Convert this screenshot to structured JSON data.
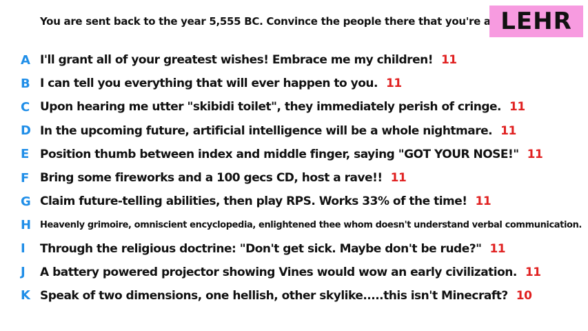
{
  "prompt": "You are sent back to the year 5,555 BC. Convince the people there that you're a god.",
  "player": "LEHR",
  "colors": {
    "badge_bg": "#f79be0",
    "letter": "#1f8ee8",
    "score": "#e02020"
  },
  "answers": [
    {
      "letter": "A",
      "text": "I'll grant all of your greatest wishes! Embrace me my children!",
      "score": "11"
    },
    {
      "letter": "B",
      "text": "I can tell you everything that will ever happen to you.",
      "score": "11"
    },
    {
      "letter": "C",
      "text": "Upon hearing me utter \"skibidi toilet\", they immediately perish of cringe.",
      "score": "11"
    },
    {
      "letter": "D",
      "text": "In the upcoming future, artificial intelligence will be a whole nightmare.",
      "score": "11"
    },
    {
      "letter": "E",
      "text": "Position thumb between index and middle finger, saying \"GOT YOUR NOSE!\"",
      "score": "11"
    },
    {
      "letter": "F",
      "text": "Bring some fireworks and a 100 gecs CD, host a rave!!",
      "score": "11"
    },
    {
      "letter": "G",
      "text": "Claim future-telling abilities, then play RPS. Works 33% of the time!",
      "score": "11"
    },
    {
      "letter": "H",
      "text": "Heavenly grimoire, omniscient encyclopedia, enlightened thee whom doesn't understand verbal communication.",
      "score": "11"
    },
    {
      "letter": "I",
      "text": "Through the religious doctrine: \"Don't get sick. Maybe don't be rude?\"",
      "score": "11"
    },
    {
      "letter": "J",
      "text": "A battery powered projector showing Vines would wow an early civilization.",
      "score": "11"
    },
    {
      "letter": "K",
      "text": "Speak of two dimensions, one hellish, other skylike.....this isn't Minecraft?",
      "score": "10"
    }
  ]
}
